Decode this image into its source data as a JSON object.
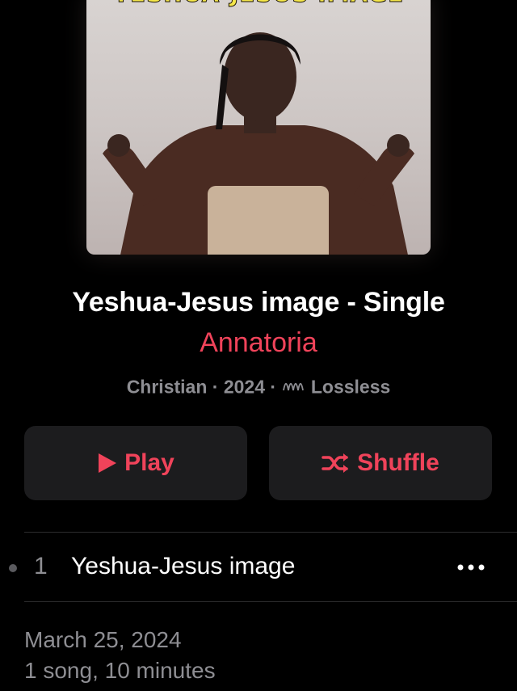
{
  "artwork": {
    "title_text": "YESHUA-JESUS IMAGE",
    "description_icon": "album-cover"
  },
  "album": {
    "title": "Yeshua-Jesus image - Single",
    "artist": "Annatoria",
    "genre": "Christian",
    "year": "2024",
    "separator": "·",
    "quality": "Lossless",
    "quality_icon": "lossless-wave-icon"
  },
  "actions": {
    "play_label": "Play",
    "play_icon": "play-icon",
    "shuffle_label": "Shuffle",
    "shuffle_icon": "shuffle-icon"
  },
  "tracks": [
    {
      "number": "1",
      "title": "Yeshua-Jesus image",
      "more_icon": "ellipsis-icon"
    }
  ],
  "footer": {
    "release_date": "March 25, 2024",
    "summary": "1 song, 10 minutes"
  },
  "colors": {
    "accent": "#f0435a",
    "background": "#000000",
    "button_bg": "#1c1c1e",
    "secondary_text": "#8e8e93"
  }
}
